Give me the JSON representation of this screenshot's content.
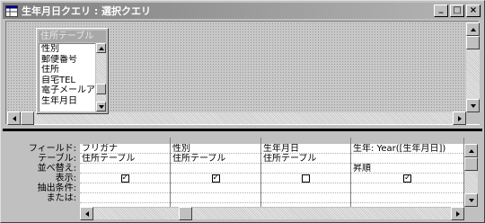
{
  "window": {
    "title": "生年月日クエリ : 選択クエリ",
    "buttons": {
      "minimize": "_",
      "maximize": "□",
      "close": "×"
    }
  },
  "table_box": {
    "title": "住所テーブル",
    "fields": [
      "性別",
      "郵便番号",
      "住所",
      "自宅TEL",
      "電子メールア",
      "生年月日"
    ]
  },
  "grid": {
    "row_labels": [
      "フィールド:",
      "テーブル:",
      "並べ替え:",
      "表示:",
      "抽出条件:",
      "または:"
    ],
    "columns": [
      {
        "field": "フリガナ",
        "table": "住所テーブル",
        "sort": "",
        "show": "☑"
      },
      {
        "field": "性別",
        "table": "住所テーブル",
        "sort": "",
        "show": "☑"
      },
      {
        "field": "生年月日",
        "table": "住所テーブル",
        "sort": "",
        "show": "☐"
      },
      {
        "field": "生年: Year([生年月日])",
        "table": "",
        "sort": "昇順",
        "show": "☑"
      }
    ],
    "checkmark": "✓"
  },
  "colors": {
    "title_start": "#808080",
    "title_end": "#b5b5b5",
    "face": "#c0c0c0"
  }
}
